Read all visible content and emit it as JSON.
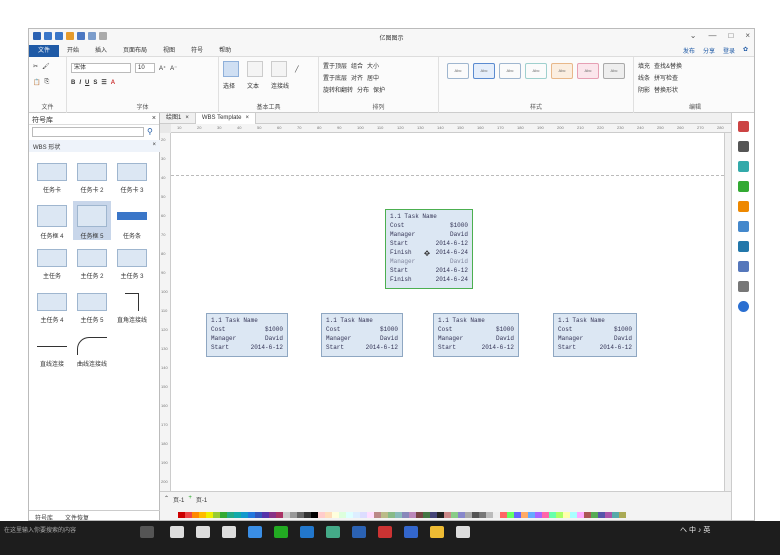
{
  "app": {
    "title": "亿图图示"
  },
  "menu": {
    "tabs": [
      "文件",
      "开始",
      "插入",
      "页面布局",
      "视图",
      "符号",
      "帮助"
    ],
    "right": [
      "发布",
      "分享",
      "登录"
    ]
  },
  "ribbon": {
    "font_name": "宋体",
    "font_size": "10",
    "groups": [
      "文件",
      "字体",
      "基本工具",
      "排列",
      "样式",
      "编辑"
    ],
    "tools": [
      "选择",
      "文本",
      "连接线"
    ],
    "arrange": [
      "置于顶层",
      "置于底层",
      "旋转和翻转",
      "组合",
      "对齐",
      "分布",
      "大小",
      "居中",
      "保护"
    ],
    "edit": [
      "填充",
      "线条",
      "阴影",
      "查找&替换",
      "拼写检查",
      "替换形状"
    ],
    "style_sample": "Abc"
  },
  "library": {
    "title": "符号库",
    "category": "WBS 形状",
    "shapes": [
      "任务卡",
      "任务卡 2",
      "任务卡 3",
      "任务框 4",
      "任务框 5",
      "任务条",
      "主任务",
      "主任务 2",
      "主任务 3",
      "主任务 4",
      "主任务 5",
      "直角连接线",
      "直线连接",
      "曲线连接线"
    ],
    "bottom_tabs": [
      "符号库",
      "文件恢复"
    ]
  },
  "doc": {
    "tabs": [
      "绘图1",
      "WBS Template"
    ],
    "page_tab": "页-1",
    "page_nav": "页-1",
    "ruler_h": [
      "10",
      "20",
      "30",
      "40",
      "50",
      "60",
      "70",
      "80",
      "90",
      "100",
      "110",
      "120",
      "130",
      "140",
      "150",
      "160",
      "170",
      "180",
      "190",
      "200",
      "210",
      "220",
      "230",
      "240",
      "250",
      "260",
      "270",
      "280"
    ],
    "ruler_v": [
      "20",
      "30",
      "40",
      "50",
      "60",
      "70",
      "80",
      "90",
      "100",
      "110",
      "120",
      "130",
      "140",
      "150",
      "160",
      "170",
      "180",
      "190",
      "200"
    ]
  },
  "cards": [
    {
      "title": "1.1 Task Name",
      "cost_label": "Cost",
      "cost": "$1000",
      "manager_label": "Manager",
      "manager": "David",
      "start_label": "Start",
      "start": "2014-6-12",
      "finish_label": "Finish",
      "finish": "2014-6-24"
    },
    {
      "title": "1.1 Task Name",
      "cost_label": "Cost",
      "cost": "$1000",
      "manager_label": "Manager",
      "manager": "David",
      "start_label": "Start",
      "start": "2014-6-12"
    },
    {
      "title": "1.1 Task Name",
      "cost_label": "Cost",
      "cost": "$1000",
      "manager_label": "Manager",
      "manager": "David",
      "start_label": "Start",
      "start": "2014-6-12"
    },
    {
      "title": "1.1 Task Name",
      "cost_label": "Cost",
      "cost": "$1000",
      "manager_label": "Manager",
      "manager": "David",
      "start_label": "Start",
      "start": "2014-6-12"
    },
    {
      "title": "1.1 Task Name",
      "cost_label": "Cost",
      "cost": "$1000",
      "manager_label": "Manager",
      "manager": "David",
      "start_label": "Start",
      "start": "2014-6-12"
    }
  ],
  "taskbar": {
    "start_label": "在这里输入你要搜索的内容",
    "tray": "へ 中 ♪ 英"
  },
  "colors": {
    "accent": "#1f5aa6",
    "card_fill": "#dce7f3",
    "card_border": "#8fa7c2",
    "selection": "#4caf50"
  }
}
